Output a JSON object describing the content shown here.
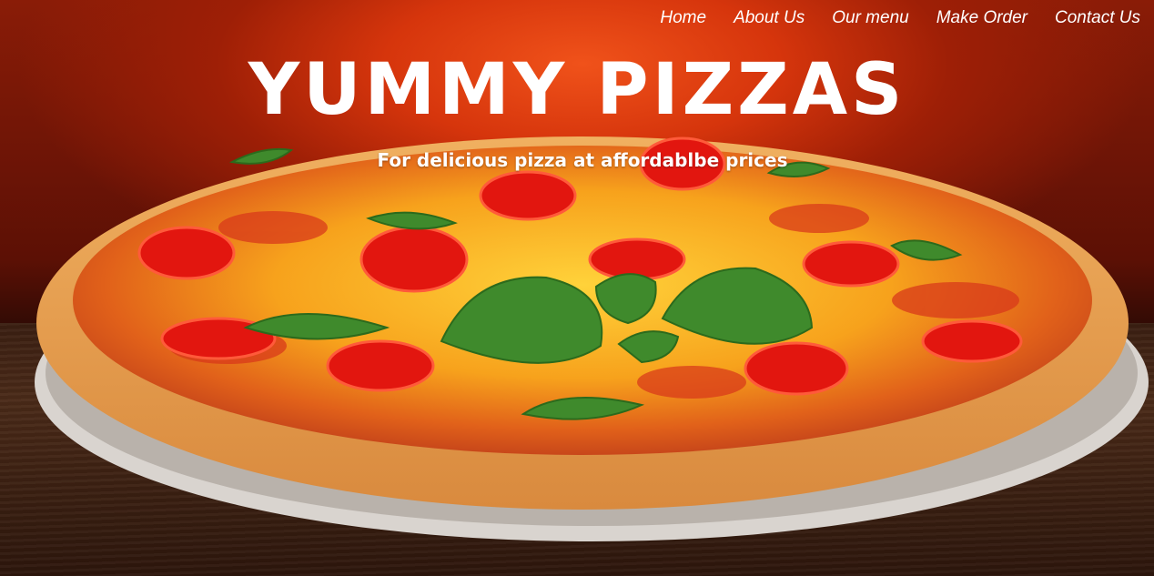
{
  "nav": {
    "items": [
      {
        "label": "Home"
      },
      {
        "label": "About Us"
      },
      {
        "label": "Our menu"
      },
      {
        "label": "Make Order"
      },
      {
        "label": "Contact Us"
      }
    ]
  },
  "hero": {
    "title": "YUMMY PIZZAS",
    "subtitle": "For delicious pizza at affordablbe prices"
  },
  "colors": {
    "accent_red": "#d6350c",
    "text": "#ffffff",
    "table_wood": "#3b1f12"
  }
}
